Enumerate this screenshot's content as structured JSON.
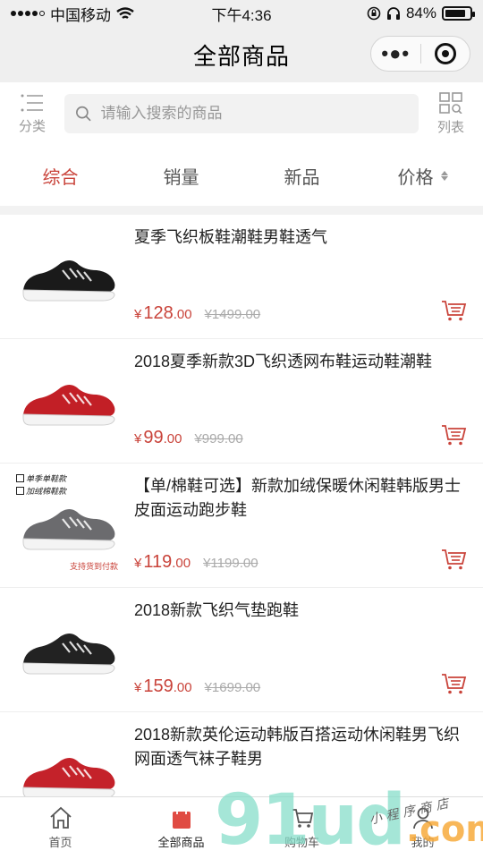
{
  "status_bar": {
    "carrier": "中国移动",
    "time": "下午4:36",
    "battery_text": "84%",
    "battery_level": 0.84
  },
  "title_bar": {
    "title": "全部商品"
  },
  "search_row": {
    "category_label": "分类",
    "placeholder": "请输入搜索的商品",
    "list_label": "列表"
  },
  "filter_tabs": [
    {
      "label": "综合",
      "active": true
    },
    {
      "label": "销量",
      "active": false
    },
    {
      "label": "新品",
      "active": false
    },
    {
      "label": "价格",
      "active": false
    }
  ],
  "products": [
    {
      "name": "夏季飞织板鞋潮鞋男鞋透气",
      "currency": "¥",
      "price_int": "128",
      "price_dec": ".00",
      "original_price": "¥1499.00",
      "shoe_color": "#1a1a1a"
    },
    {
      "name": "2018夏季新款3D飞织透网布鞋运动鞋潮鞋",
      "currency": "¥",
      "price_int": "99",
      "price_dec": ".00",
      "original_price": "¥999.00",
      "shoe_color": "#c21f26"
    },
    {
      "name": "【单/棉鞋可选】新款加绒保暖休闲鞋韩版男士皮面运动跑步鞋",
      "currency": "¥",
      "price_int": "119",
      "price_dec": ".00",
      "original_price": "¥1199.00",
      "shoe_color": "#6b6b6e",
      "image_tags": [
        "单季单鞋款",
        "加绒棉鞋款"
      ],
      "image_note": "支持货到付款"
    },
    {
      "name": "2018新款飞织气垫跑鞋",
      "currency": "¥",
      "price_int": "159",
      "price_dec": ".00",
      "original_price": "¥1699.00",
      "shoe_color": "#222222"
    },
    {
      "name": "2018新款英伦运动韩版百搭运动休闲鞋男飞织网面透气袜子鞋男",
      "currency": "¥",
      "price_int": "",
      "price_dec": "",
      "original_price": "",
      "shoe_color": "#c4222a"
    }
  ],
  "tab_bar": [
    {
      "label": "首页",
      "icon": "home-icon",
      "active": false
    },
    {
      "label": "全部商品",
      "icon": "shopping-bag-icon",
      "active": true
    },
    {
      "label": "购物车",
      "icon": "cart-icon",
      "active": false
    },
    {
      "label": "我的",
      "icon": "user-icon",
      "active": false
    }
  ],
  "watermark": {
    "text": "91ud",
    "domain": ".com",
    "script": "小程序商店"
  },
  "colors": {
    "accent": "#c9433a",
    "muted": "#999999"
  }
}
